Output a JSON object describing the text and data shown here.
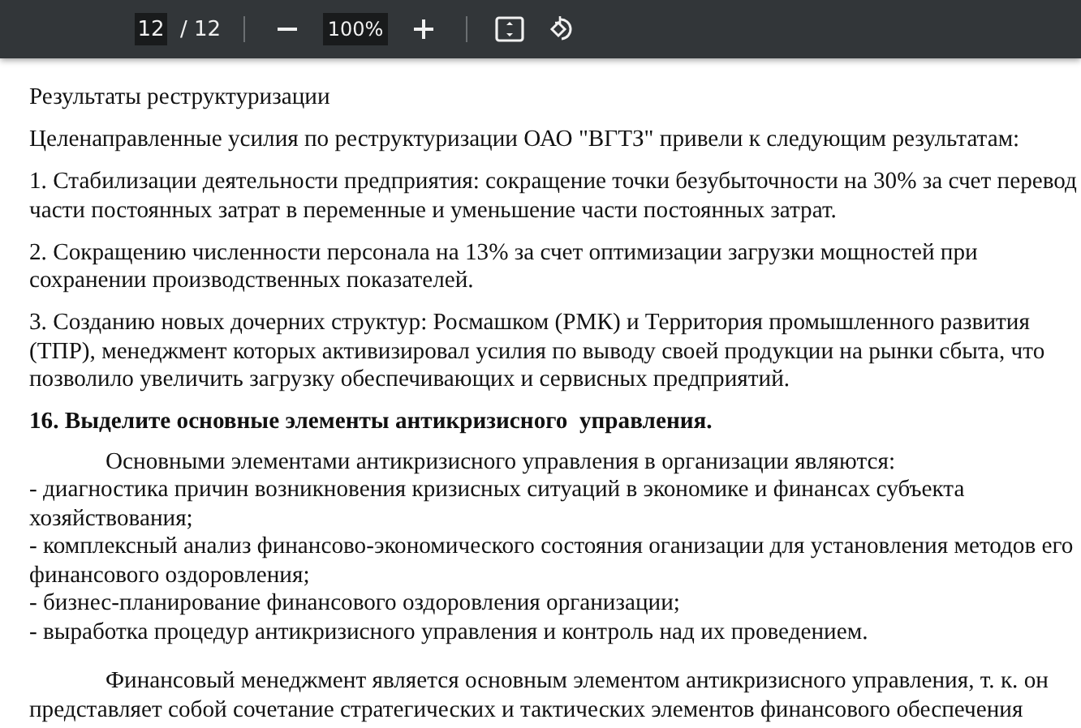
{
  "toolbar": {
    "page_number": "12",
    "page_total": "/ 12",
    "zoom": "100%"
  },
  "paragraphs": [
    {
      "kind": "plain",
      "lines": [
        "Результаты реструктуризации"
      ]
    },
    {
      "kind": "plain",
      "lines": [
        "Целенаправленные усилия по реструктуризации ОАО \"ВГТЗ\" привели к следующим результатам:"
      ]
    },
    {
      "kind": "plain",
      "lines": [
        "1. Стабилизации деятельности предприятия: сокращение точки безубыточности на 30% за счет перевод",
        "части постоянных затрат в переменные и уменьшение части постоянных затрат."
      ]
    },
    {
      "kind": "plain",
      "lines": [
        "2. Сокращению численности персонала на 13% за счет оптимизации загрузки мощностей при",
        "сохранении производственных показателей."
      ]
    },
    {
      "kind": "plain",
      "lines": [
        "3. Созданию новых дочерних структур: Росмашком (РМК) и Территория промышленного развития",
        "(ТПР), менеджмент которых активизировал усилия по выводу своей продукции на рынки сбыта, что",
        "позволило увеличить загрузку обеспечивающих и сервисных предприятий."
      ]
    },
    {
      "kind": "heading",
      "lines": [
        "16. Выделите основные элементы антикризисного  управления."
      ]
    },
    {
      "kind": "indented",
      "lines": [
        "Основными элементами антикризисного управления в организации являются:",
        "- диагностика причин возникновения кризисных ситуаций в экономике и финансах субъекта",
        "хозяйствования;",
        "- комплексный анализ финансово-экономического состояния оганизации для установления методов его",
        "финансового оздоровления;",
        "- бизнес-планирование финансового оздоровления организации;",
        "- выработка процедур антикризисного управления и контроль над их проведением."
      ]
    },
    {
      "kind": "indented",
      "lines": [
        "Финансовый менеджмент является основным элементом антикризисного управления, т. к. он",
        "представляет собой сочетание стратегических и тактических элементов финансового обеспечения"
      ]
    }
  ]
}
